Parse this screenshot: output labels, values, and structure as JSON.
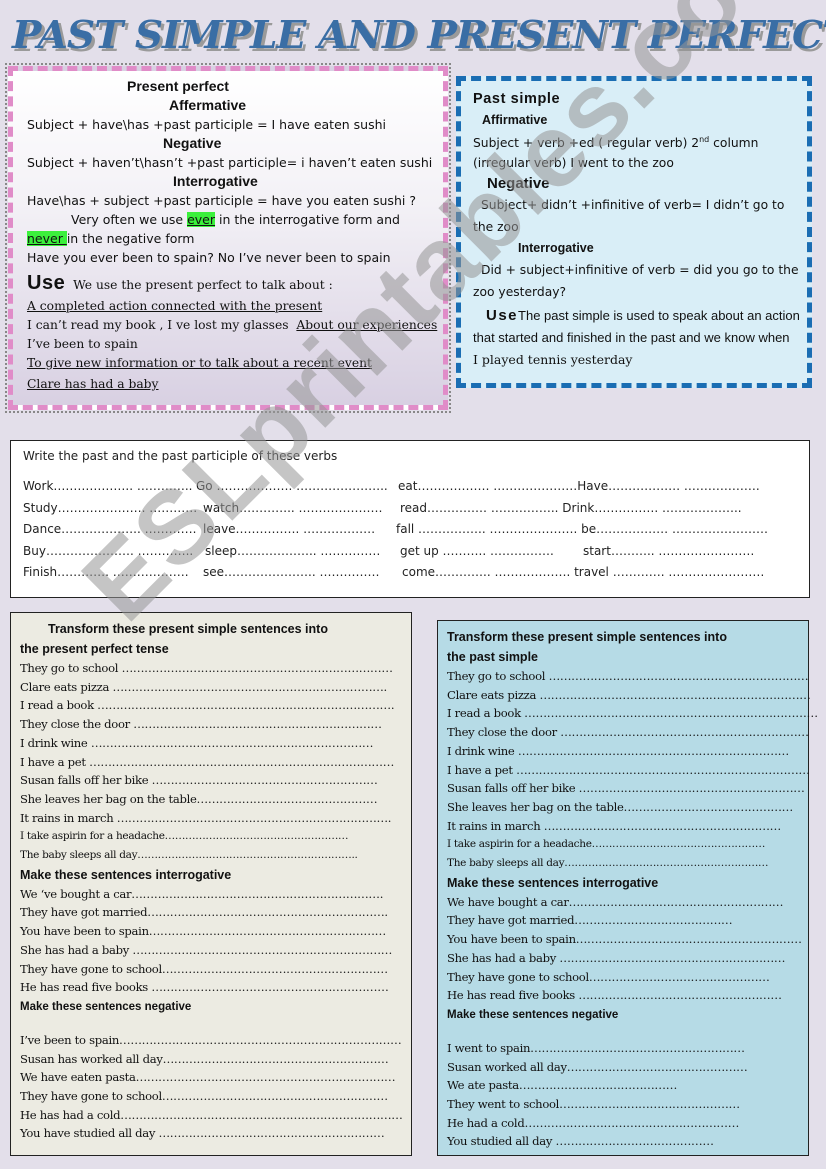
{
  "title": "PAST SIMPLE AND PRESENT PERFECT",
  "present_perfect": {
    "heading": "Present perfect",
    "affirmative_label": "Affermative",
    "affirmative_rule": "Subject + have\\has +past participle = I have eaten  sushi",
    "negative_label": "Negative",
    "negative_rule": "Subject + haven’t\\hasn’t +past participle= i haven’t eaten sushi",
    "interrogative_label": "Interrogative",
    "interrogative_rule": "Have\\has + subject +past participle = have you eaten sushi ?",
    "note_pre": "Very often we use ",
    "note_ever": "ever",
    "note_mid": " in the interrogative form and",
    "note_never": "never ",
    "note_post": "in the negative form",
    "example": "Have you ever been to spain? No I’ve never been to spain",
    "use_label": "Use",
    "use_intro": "We use the present perfect to talk about :",
    "use_1": "A completed action connected with the present",
    "use_1_example": "I can’t read my book , I ve lost my glasses",
    "use_2": "About our experiences",
    "use_2_example": "I’ve been to spain",
    "use_3": "To give new information or to talk about a recent event",
    "use_3_example": "Clare has had a baby"
  },
  "past_simple": {
    "heading": "Past simple",
    "affirmative_label": "Affirmative",
    "affirmative_rule_a": "Subject + verb +ed ( regular verb) 2",
    "affirmative_rule_sup": "nd",
    "affirmative_rule_b": " column (irregular verb) I went to the zoo",
    "negative_label": "Negative",
    "negative_rule": "Subject+  didn’t +infinitive of verb= I didn’t go to the zoo",
    "interrogative_label": "Interrogative",
    "interrogative_rule": "Did + subject+infinitive of verb = did you go to the zoo yesterday?",
    "use_label": "Use",
    "use_text": "The past simple is used to speak about an action that started and finished in the past and we know when",
    "use_example": "I played tennis yesterday"
  },
  "verbs_exercise": {
    "title": "Write the past and the past participle of these verbs",
    "rows": [
      [
        "Work……………….. …………..",
        "Go ……………….  …………………..",
        "eat……………… …………………Have……………… ………………."
      ],
      [
        "Study…………………. …………",
        "watch………….. …………………",
        "read…………… …………….. Drink……………. ……………….."
      ],
      [
        "Dance……………….. ………….",
        "leave……………. ………………",
        "fall …………….. …………………. be……………… ……………………"
      ],
      [
        "Buy…………………. …………..",
        "sleep……………….. ……………",
        "get up ……….. …………….",
        "start………..     ……………………"
      ],
      [
        "Finish…………. ……………….",
        "see………………….. ……………",
        "come………….. ………………. travel …………. ……………………"
      ]
    ]
  },
  "exercise_present_perfect": {
    "heading": "Transform these present simple sentences  into the present perfect tense",
    "heading_line1": "Transform these present simple sentences  into",
    "heading_line2": "the present perfect tense",
    "transform_items": [
      "They go  to school ………………………………………………………………",
      "Clare eats pizza ……………………………………………………………….",
      "I read a book …………………………………………………………………….",
      "They close the door …………………………………………………………",
      "I  drink wine    …………………………………………………………………",
      "I have a pet ………………………………………………………………………",
      "Susan falls off her bike ……………………………………………………",
      "She leaves her bag on the table…………………………………………",
      "It rains in march ……………………………………………………………….",
      "I take aspirin for a headache………………………………………………",
      "The baby sleeps all day……………………………………………………….."
    ],
    "interrogative_heading": "Make these sentences interrogative",
    "interrogative_items": [
      "We ‘ve bought  a   car………………………………………………………….",
      "They have got married……………………………………………………….",
      "You have been to spain………………………………………………………",
      "She has had a baby ……………………………………………………………",
      "They have gone to school……………………………………………………",
      "He has read five books ………………………………………………………"
    ],
    "negative_heading": "Make these sentences negative",
    "negative_items": [
      "I’ve been to spain…………………………………………………………………",
      "Susan has worked all day……………………………………………………",
      "We have eaten pasta……………………………………………………………",
      "They have gone to school……………………………………………………",
      "He has had a cold…………………………………………………………………",
      "You have studied all day ……………………………………………………"
    ]
  },
  "exercise_past_simple": {
    "heading_line1": "Transform these present simple sentences  into",
    "heading_line2": "the past simple",
    "transform_items": [
      "They go  to school ……………………………………………………………",
      "Clare eats pizza ………………………………………………………………",
      "I read a book ……………………………………………………………………",
      "They close the door …………………………………………………………",
      "I  drink wine    ………………………………………………………………",
      "I have a pet ……………………………………………………………………",
      "Susan falls off her bike ……………………………………………………",
      "She leaves her bag on the table………………………………………",
      "It rains in march ………………………………………………………",
      "I take aspirin for a headache……………………………………………",
      "The baby sleeps all day……………………………………………………"
    ],
    "interrogative_heading": "Make these sentences interrogative",
    "interrogative_items": [
      "We have bought   a   car…………………………………………………",
      "They have got married……………………………………",
      "You have been to spain……………………………………………………",
      "She has had a baby ……………………………………………………",
      "They have gone to school…………………………………………",
      "He has read five books ………………………………………………"
    ],
    "negative_heading": "Make these sentences negative",
    "negative_items": [
      "I went to spain…………………………………………………",
      "Susan  worked all day…………………………………………",
      "We ate  pasta……………………………………",
      "They went  to school…………………………………………",
      "He  had a cold…………………………………………………",
      "You  studied all day ……………………………………"
    ]
  },
  "watermark": "ESLprintables.com",
  "colors": {
    "page_background": "#e3dfea",
    "title_blue": "#3a6ea5",
    "pink_border": "#e08cc8",
    "blue_border": "#1a6db3",
    "past_simple_bg": "#d9eef7",
    "left_exercise_bg": "#ecebe2",
    "right_exercise_bg": "#b6dbe6",
    "highlight_green": "#3cf03c"
  }
}
